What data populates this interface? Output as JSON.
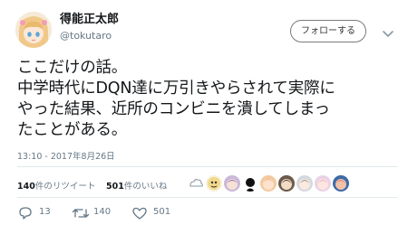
{
  "user": {
    "display_name": "得能正太郎",
    "handle": "@tokutaro",
    "avatar_icon": "anime-girl-avatar-icon"
  },
  "header": {
    "follow_label": "フォローする",
    "menu_icon": "chevron-down-icon"
  },
  "tweet": {
    "lines": [
      "ここだけの話。",
      "中学時代にDQN達に万引きやらされて実際に",
      "やった結果、近所のコンビニを潰してしまっ",
      "たことがある。"
    ],
    "timestamp": "13:10 - 2017年8月26日"
  },
  "stats": {
    "retweets_count": "140",
    "retweets_label": "件のリツイート",
    "likes_count": "501",
    "likes_label": "件のいいね"
  },
  "actions": {
    "reply_count": "13",
    "retweet_count": "140",
    "like_count": "501"
  },
  "colors": {
    "text": "#14171a",
    "secondary": "#657786",
    "divider": "#e1e8ed"
  }
}
